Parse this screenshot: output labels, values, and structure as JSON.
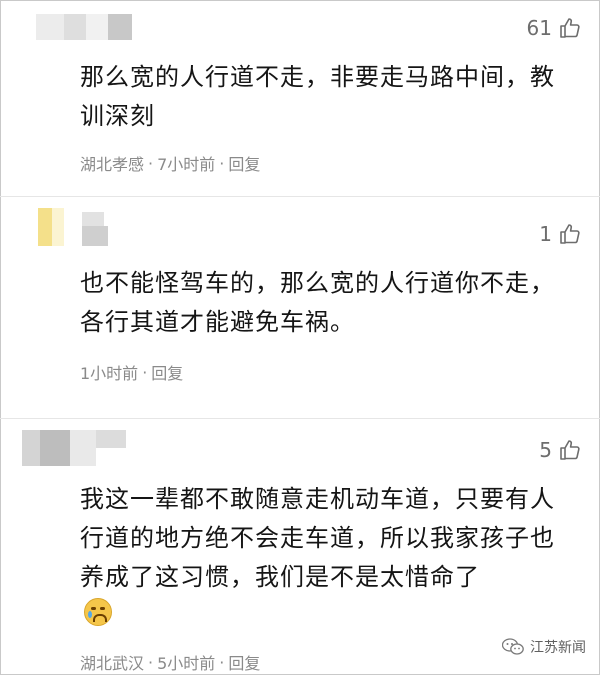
{
  "comments": [
    {
      "likes": "61",
      "text": "那么宽的人行道不走，非要走马路中间，教训深刻",
      "location": "湖北孝感",
      "time": "7小时前",
      "sep": "·",
      "reply": "回复"
    },
    {
      "likes": "1",
      "text": "也不能怪驾车的，那么宽的人行道你不走，各行其道才能避免车祸。",
      "location": "",
      "time": "1小时前",
      "sep": "·",
      "reply": "回复"
    },
    {
      "likes": "5",
      "text": "我这一辈都不敢随意走机动车道，只要有人行道的地方绝不会走车道，所以我家孩子也养成了这习惯，我们是不是太惜命了",
      "location": "湖北武汉",
      "time": "5小时前",
      "sep": "·",
      "reply": "回复",
      "emoji": "crying-face-icon"
    }
  ],
  "watermark": {
    "icon": "wechat-icon",
    "label": "江苏新闻"
  },
  "colors": {
    "text": "#151515",
    "meta": "#8a8a8a",
    "likes": "#6d6d6d"
  }
}
